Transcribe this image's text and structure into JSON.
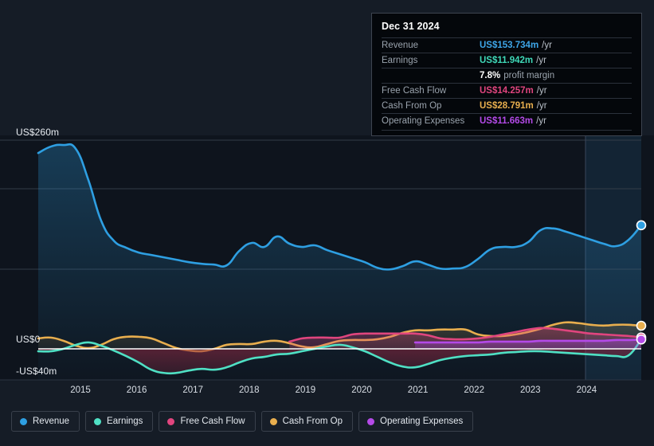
{
  "chart_data": {
    "type": "area",
    "title": "",
    "xlabel": "",
    "ylabel": "",
    "grid": true,
    "legend_position": "bottom",
    "x_tick_labels": [
      "2015",
      "2016",
      "2017",
      "2018",
      "2019",
      "2020",
      "2021",
      "2022",
      "2023",
      "2024"
    ],
    "y_tick_labels": [
      "US$260m",
      "US$0",
      "-US$40m"
    ],
    "ylim": [
      -40,
      260
    ],
    "y_axis_top_label": "US$260m",
    "y_axis_zero_label": "US$0",
    "y_axis_bottom_label": "-US$40m",
    "units": "US$ millions",
    "series": [
      {
        "name": "Revenue",
        "color": "#2e9fe2",
        "values": [
          244,
          252,
          254,
          249,
          210,
          160,
          135,
          126,
          120,
          117,
          114,
          111,
          108,
          106,
          105,
          104,
          122,
          132,
          127,
          140,
          131,
          127,
          129,
          123,
          118,
          113,
          108,
          101,
          99,
          103,
          109,
          105,
          100,
          100,
          102,
          112,
          124,
          127,
          127,
          133,
          148,
          150,
          146,
          141,
          136,
          131,
          128,
          136,
          154
        ]
      },
      {
        "name": "Earnings",
        "color": "#4fe0c4",
        "values": [
          -3,
          -3,
          0,
          5,
          8,
          4,
          -2,
          -9,
          -17,
          -26,
          -30,
          -30,
          -27,
          -25,
          -26,
          -23,
          -17,
          -12,
          -10,
          -7,
          -6,
          -3,
          0,
          3,
          5,
          2,
          -3,
          -10,
          -17,
          -22,
          -23,
          -19,
          -14,
          -11,
          -9,
          -8,
          -7,
          -5,
          -4,
          -3,
          -3,
          -4,
          -5,
          -6,
          -7,
          -8,
          -9,
          -8,
          11.942
        ]
      },
      {
        "name": "Free Cash Flow",
        "color": "#e0457e",
        "start_index": 20,
        "values": [
          null,
          null,
          null,
          null,
          null,
          null,
          null,
          null,
          null,
          null,
          null,
          null,
          null,
          null,
          null,
          null,
          null,
          null,
          null,
          null,
          9,
          13,
          14,
          14,
          14,
          18,
          19,
          19,
          19,
          19,
          19,
          17,
          13,
          12,
          12,
          13,
          15,
          18,
          21,
          24,
          26,
          25,
          23,
          21,
          19,
          18,
          17,
          16,
          14.257
        ]
      },
      {
        "name": "Cash From Op",
        "color": "#e8ae4e",
        "values": [
          13,
          14,
          10,
          4,
          1,
          5,
          12,
          15,
          15,
          13,
          7,
          1,
          -2,
          -3,
          0,
          5,
          6,
          6,
          9,
          10,
          7,
          3,
          2,
          6,
          10,
          11,
          11,
          12,
          15,
          20,
          23,
          23,
          24,
          24,
          24,
          18,
          16,
          16,
          18,
          21,
          25,
          30,
          33,
          32,
          30,
          29,
          30,
          30,
          28.791
        ]
      },
      {
        "name": "Operating Expenses",
        "color": "#b44ae8",
        "start_index": 30,
        "values": [
          null,
          null,
          null,
          null,
          null,
          null,
          null,
          null,
          null,
          null,
          null,
          null,
          null,
          null,
          null,
          null,
          null,
          null,
          null,
          null,
          null,
          null,
          null,
          null,
          null,
          null,
          null,
          null,
          null,
          null,
          8,
          8,
          8,
          8,
          8,
          8,
          9,
          9,
          9,
          9,
          10,
          10,
          10,
          10,
          10,
          10,
          11,
          11,
          11.663
        ]
      }
    ]
  },
  "tooltip": {
    "date": "Dec 31 2024",
    "rows": [
      {
        "label": "Revenue",
        "value": "US$153.734m",
        "unit": "/yr",
        "color": "#3ea6e8"
      },
      {
        "label": "Earnings",
        "value": "US$11.942m",
        "unit": "/yr",
        "color": "#3fd9b8"
      },
      {
        "label": "",
        "value": "7.8%",
        "unit": "",
        "margin_label": "profit margin",
        "color": "#ffffff"
      },
      {
        "label": "Free Cash Flow",
        "value": "US$14.257m",
        "unit": "/yr",
        "color": "#e0457e"
      },
      {
        "label": "Cash From Op",
        "value": "US$28.791m",
        "unit": "/yr",
        "color": "#e8ae4e"
      },
      {
        "label": "Operating Expenses",
        "value": "US$11.663m",
        "unit": "/yr",
        "color": "#b44ae8"
      }
    ]
  },
  "legend": {
    "items": [
      {
        "label": "Revenue",
        "color": "#2e9fe2"
      },
      {
        "label": "Earnings",
        "color": "#4fe0c4"
      },
      {
        "label": "Free Cash Flow",
        "color": "#e0457e"
      },
      {
        "label": "Cash From Op",
        "color": "#e8ae4e"
      },
      {
        "label": "Operating Expenses",
        "color": "#b44ae8"
      }
    ]
  }
}
